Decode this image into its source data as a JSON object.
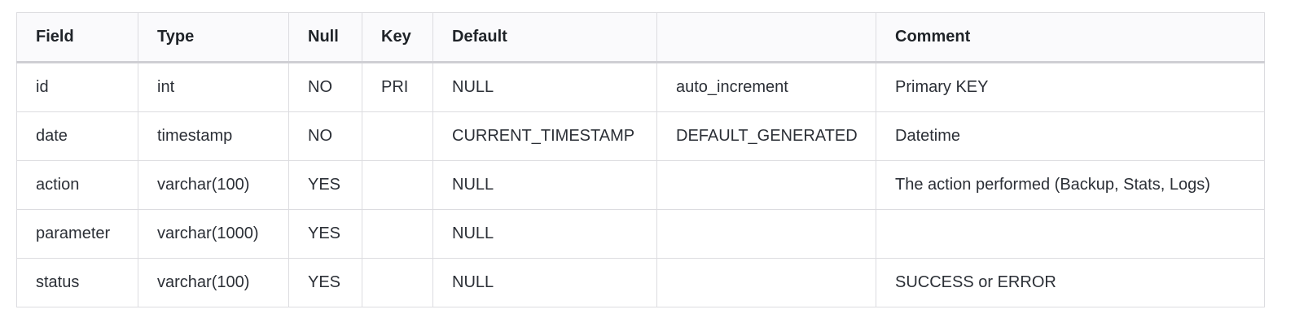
{
  "table": {
    "headers": [
      "Field",
      "Type",
      "Null",
      "Key",
      "Default",
      "",
      "Comment"
    ],
    "rows": [
      [
        "id",
        "int",
        "NO",
        "PRI",
        "NULL",
        "auto_increment",
        "Primary KEY"
      ],
      [
        "date",
        "timestamp",
        "NO",
        "",
        "CURRENT_TIMESTAMP",
        "DEFAULT_GENERATED",
        "Datetime"
      ],
      [
        "action",
        "varchar(100)",
        "YES",
        "",
        "NULL",
        "",
        "The action performed (Backup, Stats, Logs)"
      ],
      [
        "parameter",
        "varchar(1000)",
        "YES",
        "",
        "NULL",
        "",
        ""
      ],
      [
        "status",
        "varchar(100)",
        "YES",
        "",
        "NULL",
        "",
        "SUCCESS or ERROR"
      ]
    ]
  },
  "colors": {
    "border": "#dcdce0",
    "header_bg": "#fafafc",
    "text": "#1f2328"
  }
}
